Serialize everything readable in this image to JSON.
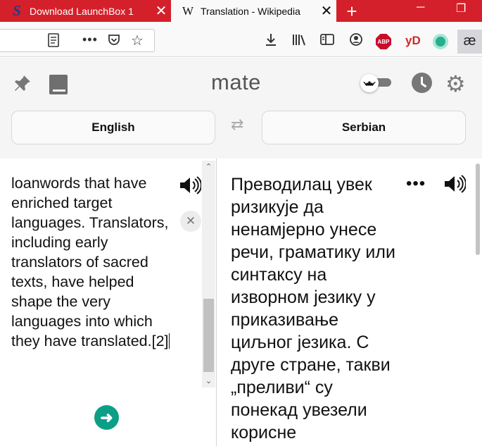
{
  "browser": {
    "tabs": [
      {
        "favicon": "S",
        "title": "Download LaunchBox 1",
        "close": "✕"
      },
      {
        "favicon": "W",
        "title": "Translation - Wikipedia",
        "close": "✕"
      }
    ],
    "new_tab": "+",
    "window_controls": {
      "minimize": "─",
      "restore": "❐"
    },
    "toolbar_icons": {
      "download": "download-icon",
      "library": "library-icon",
      "sidebar": "sidebar-icon",
      "account": "account-icon",
      "abp_label": "ABP",
      "yd_label": "yD",
      "ae_label": "æ"
    }
  },
  "app": {
    "brand": "mate",
    "source_language": "English",
    "target_language": "Serbian",
    "source_text": "loanwords that have enriched target languages. Translators, including early translators of sacred texts, have helped shape the very languages into which they have translated.[2]",
    "target_text": "Преводилац увек ризикује да ненамјерно унесе речи, граматику или синтаксу на изворном језику у приказивање циљног језика. С друге стране, такви „преливи“ су понекад увезели корисне",
    "source_scroll_fraction": 0.6,
    "target_scroll_fraction": 0.0
  },
  "colors": {
    "tabbar": "#d4202a",
    "accent_green": "#0d9e86"
  }
}
